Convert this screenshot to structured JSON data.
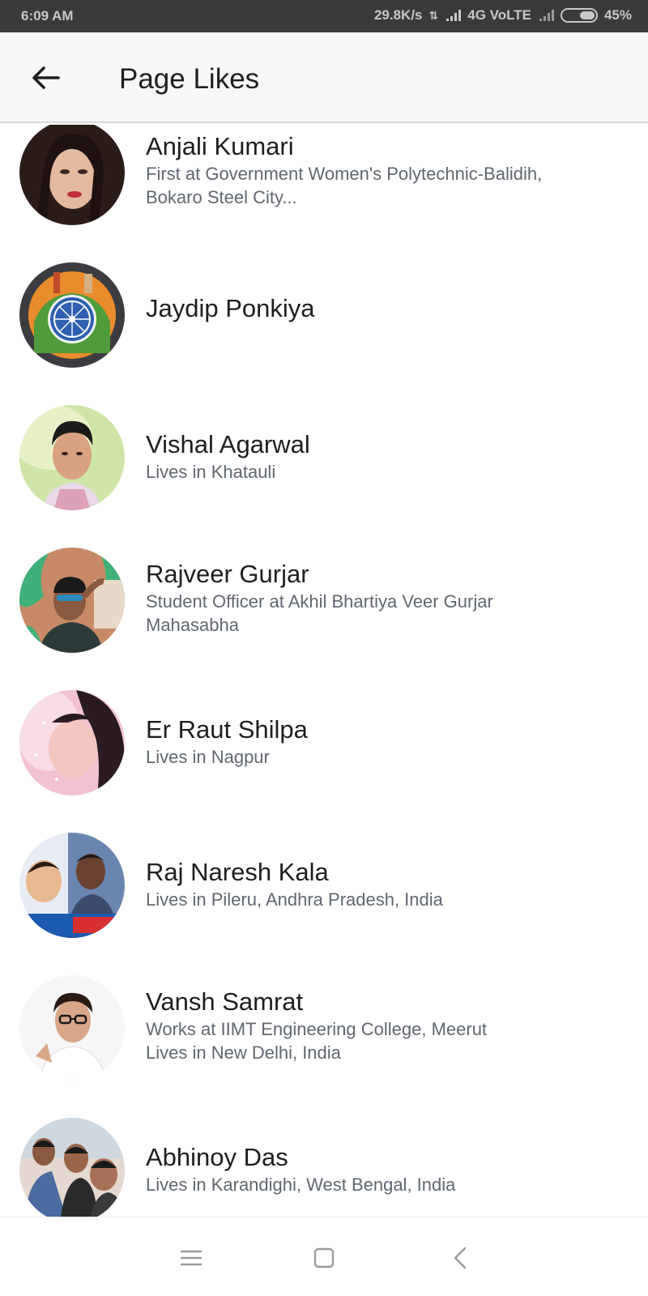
{
  "status_bar": {
    "time": "6:09 AM",
    "network_speed": "29.8K/s",
    "network_type": "4G VoLTE",
    "battery": "45%"
  },
  "header": {
    "title": "Page Likes",
    "back_icon": "arrow-left-icon"
  },
  "people": [
    {
      "name": "Anjali Kumari",
      "line1": "First at Government Women's Polytechnic-Balidih,",
      "line2": "Bokaro Steel City..."
    },
    {
      "name": "Jaydip Ponkiya",
      "line1": "",
      "line2": ""
    },
    {
      "name": "Vishal Agarwal",
      "line1": "Lives in Khatauli",
      "line2": ""
    },
    {
      "name": "Rajveer Gurjar",
      "line1": "Student Officer at Akhil Bhartiya Veer Gurjar",
      "line2": "Mahasabha"
    },
    {
      "name": "Er Raut Shilpa",
      "line1": "Lives in Nagpur",
      "line2": ""
    },
    {
      "name": "Raj Naresh Kala",
      "line1": "Lives in Pileru, Andhra Pradesh, India",
      "line2": ""
    },
    {
      "name": "Vansh Samrat",
      "line1": "Works at IIMT Engineering College, Meerut",
      "line2": "Lives in New Delhi, India"
    },
    {
      "name": "Abhinoy Das",
      "line1": "Lives in Karandighi, West Bengal, India",
      "line2": ""
    }
  ],
  "nav_bar": {
    "menu_icon": "menu-icon",
    "home_icon": "home-square-icon",
    "back_icon": "back-chevron-icon"
  },
  "colors": {
    "status_bar_bg": "#3a3a3a",
    "header_bg": "#f7f7f7",
    "name_text": "#1c1e21",
    "secondary_text": "#606770"
  }
}
